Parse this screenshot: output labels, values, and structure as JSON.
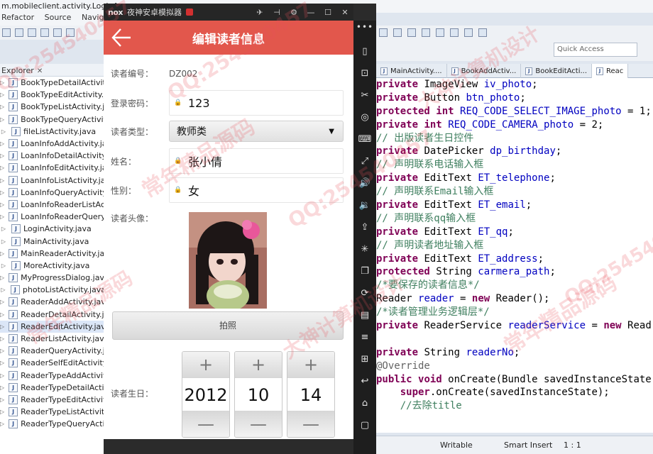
{
  "ide": {
    "title": "m.mobileclient.activity.LoginAc",
    "menu": [
      "Refactor",
      "Source",
      "Navigate"
    ],
    "explorer_tab": "Explorer",
    "explorer_close": "✕",
    "files": [
      "BookTypeDetailActivity.java",
      "BookTypeEditActivity.java",
      "BookTypeListActivity.java",
      "BookTypeQueryActivity.java",
      "fileListActivity.java",
      "LoanInfoAddActivity.java",
      "LoanInfoDetailActivity.java",
      "LoanInfoEditActivity.java",
      "LoanInfoListActivity.java",
      "LoanInfoQueryActivity.java",
      "LoanInfoReaderListActivity.java",
      "LoanInfoReaderQueryActivity.java",
      "LoginActivity.java",
      "MainActivity.java",
      "MainReaderActivity.java",
      "MoreActivity.java",
      "MyProgressDialog.java",
      "photoListActivity.java",
      "ReaderAddActivity.java",
      "ReaderDetailActivity.java",
      "ReaderEditActivity.java",
      "ReaderListActivity.java",
      "ReaderQueryActivity.java",
      "ReaderSelfEditActivity.java",
      "ReaderTypeAddActivity.java",
      "ReaderTypeDetailActivity.java",
      "ReaderTypeEditActivity.java",
      "ReaderTypeListActivity.java",
      "ReaderTypeQueryActivity.java"
    ],
    "quick_access_placeholder": "Quick Access",
    "editor_tabs": [
      "MainActivity....",
      "BookAddActiv...",
      "BookEditActi...",
      "Reac"
    ],
    "code_lines": [
      [
        {
          "t": "private",
          "c": "kw"
        },
        {
          "t": " ImageView "
        },
        {
          "t": "iv_photo",
          "c": "fld"
        },
        {
          "t": ";"
        }
      ],
      [
        {
          "t": "private",
          "c": "kw"
        },
        {
          "t": " Button "
        },
        {
          "t": "btn_photo",
          "c": "fld"
        },
        {
          "t": ";"
        }
      ],
      [
        {
          "t": "protected",
          "c": "kw"
        },
        {
          "t": " "
        },
        {
          "t": "int",
          "c": "kw"
        },
        {
          "t": " "
        },
        {
          "t": "REQ_CODE_SELECT_IMAGE_photo",
          "c": "fld"
        },
        {
          "t": " = 1;"
        }
      ],
      [
        {
          "t": "private",
          "c": "kw"
        },
        {
          "t": " "
        },
        {
          "t": "int",
          "c": "kw"
        },
        {
          "t": " "
        },
        {
          "t": "REQ_CODE_CAMERA_photo",
          "c": "fld"
        },
        {
          "t": " = 2;"
        }
      ],
      [
        {
          "t": "// 出版读者生日控件",
          "c": "cmt"
        }
      ],
      [
        {
          "t": "private",
          "c": "kw"
        },
        {
          "t": " DatePicker "
        },
        {
          "t": "dp_birthday",
          "c": "fld"
        },
        {
          "t": ";"
        }
      ],
      [
        {
          "t": "// 声明联系电话输入框",
          "c": "cmt"
        }
      ],
      [
        {
          "t": "private",
          "c": "kw"
        },
        {
          "t": " EditText "
        },
        {
          "t": "ET_telephone",
          "c": "fld"
        },
        {
          "t": ";"
        }
      ],
      [
        {
          "t": "// 声明联系Email输入框",
          "c": "cmt"
        }
      ],
      [
        {
          "t": "private",
          "c": "kw"
        },
        {
          "t": " EditText "
        },
        {
          "t": "ET_email",
          "c": "fld"
        },
        {
          "t": ";"
        }
      ],
      [
        {
          "t": "// 声明联系qq输入框",
          "c": "cmt"
        }
      ],
      [
        {
          "t": "private",
          "c": "kw"
        },
        {
          "t": " EditText "
        },
        {
          "t": "ET_qq",
          "c": "fld"
        },
        {
          "t": ";"
        }
      ],
      [
        {
          "t": "// 声明读者地址输入框",
          "c": "cmt"
        }
      ],
      [
        {
          "t": "private",
          "c": "kw"
        },
        {
          "t": " EditText "
        },
        {
          "t": "ET_address",
          "c": "fld"
        },
        {
          "t": ";"
        }
      ],
      [
        {
          "t": "protected",
          "c": "kw"
        },
        {
          "t": " String "
        },
        {
          "t": "carmera_path",
          "c": "fld"
        },
        {
          "t": ";"
        }
      ],
      [
        {
          "t": "/*要保存的读者信息*/",
          "c": "cmt"
        }
      ],
      [
        {
          "t": "Reader "
        },
        {
          "t": "reader",
          "c": "fld"
        },
        {
          "t": " = "
        },
        {
          "t": "new",
          "c": "kw"
        },
        {
          "t": " Reader();"
        }
      ],
      [
        {
          "t": "/*读者管理业务逻辑层*/",
          "c": "cmt"
        }
      ],
      [
        {
          "t": "private",
          "c": "kw"
        },
        {
          "t": " ReaderService "
        },
        {
          "t": "readerService",
          "c": "fld"
        },
        {
          "t": " = "
        },
        {
          "t": "new",
          "c": "kw"
        },
        {
          "t": " Read"
        }
      ],
      [
        {
          "t": ""
        }
      ],
      [
        {
          "t": "private",
          "c": "kw"
        },
        {
          "t": " String "
        },
        {
          "t": "readerNo",
          "c": "fld"
        },
        {
          "t": ";"
        }
      ],
      [
        {
          "t": "@Override",
          "c": "ann"
        }
      ],
      [
        {
          "t": "public",
          "c": "kw"
        },
        {
          "t": " "
        },
        {
          "t": "void",
          "c": "kw"
        },
        {
          "t": " onCreate(Bundle savedInstanceState"
        }
      ],
      [
        {
          "t": "    "
        },
        {
          "t": "super",
          "c": "kw"
        },
        {
          "t": ".onCreate(savedInstanceState);"
        }
      ],
      [
        {
          "t": "    //去除title",
          "c": "cmt"
        }
      ]
    ],
    "status": {
      "writable": "Writable",
      "insert": "Smart Insert",
      "position": "1 : 1"
    }
  },
  "emulator": {
    "logo": "nox",
    "title": "夜神安卓模拟器",
    "win_controls": [
      "✈",
      "⊣",
      "⚙",
      "—",
      "☐",
      "✕"
    ],
    "side_icons": [
      "phone-icon",
      "robot-icon",
      "scissors-icon",
      "location-icon",
      "keyboard-icon",
      "fullscreen-icon",
      "volume-up-icon",
      "volume-down-icon",
      "apk-icon",
      "shake-icon",
      "multi-instance-icon",
      "macro-icon",
      "video-icon",
      "menu-icon",
      "expand-icon",
      "back-icon",
      "home-icon",
      "recent-icon"
    ]
  },
  "app": {
    "title": "编辑读者信息",
    "fields": {
      "reader_no_label": "读者编号：",
      "reader_no_value": "DZ002",
      "password_label": "登录密码：",
      "password_value": "123",
      "type_label": "读者类型：",
      "type_value": "教师类",
      "name_label": "姓名：",
      "name_value": "张小倩",
      "gender_label": "性别：",
      "gender_value": "女",
      "photo_label": "读者头像：",
      "photo_button": "拍照",
      "birthday_label": "读者生日："
    },
    "date_picker": {
      "plus": "+",
      "minus": "—",
      "year": "2012",
      "month": "10",
      "day": "14"
    },
    "accent": "#e2574c"
  },
  "watermarks": [
    "QQ:254540457",
    "常年精品源码",
    "大神计算机设计"
  ]
}
